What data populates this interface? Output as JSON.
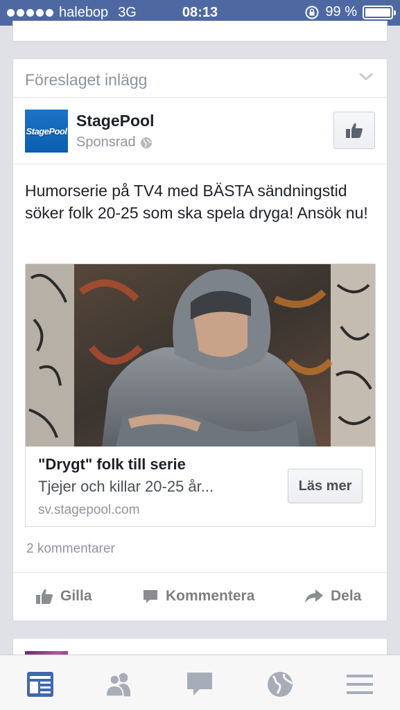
{
  "status_bar": {
    "carrier": "halebop",
    "network": "3G",
    "time": "08:13",
    "battery": "99 %",
    "battery_level": 0.99
  },
  "post": {
    "suggestion_label": "Föreslaget inlägg",
    "page_name": "StagePool",
    "page_logo_text": "StagePool",
    "sponsored_label": "Sponsrad",
    "text": "Humorserie på TV4 med BÄSTA sändningstid söker folk 20-25 som ska spela dryga! Ansök nu!",
    "link": {
      "title": "\"Drygt\" folk till serie",
      "description": "Tjejer och killar 20-25 år...",
      "domain": "sv.stagepool.com",
      "cta": "Läs mer"
    },
    "comments_count": "2 kommentarer",
    "actions": {
      "like": "Gilla",
      "comment": "Kommentera",
      "share": "Dela"
    }
  },
  "tabs": [
    "news-feed-icon",
    "friends-icon",
    "messages-icon",
    "globe-icon",
    "menu-icon"
  ],
  "colors": {
    "status_bar": "#4e69a2",
    "active_tab": "#4267b2",
    "inactive_tab": "#a7adb8"
  }
}
